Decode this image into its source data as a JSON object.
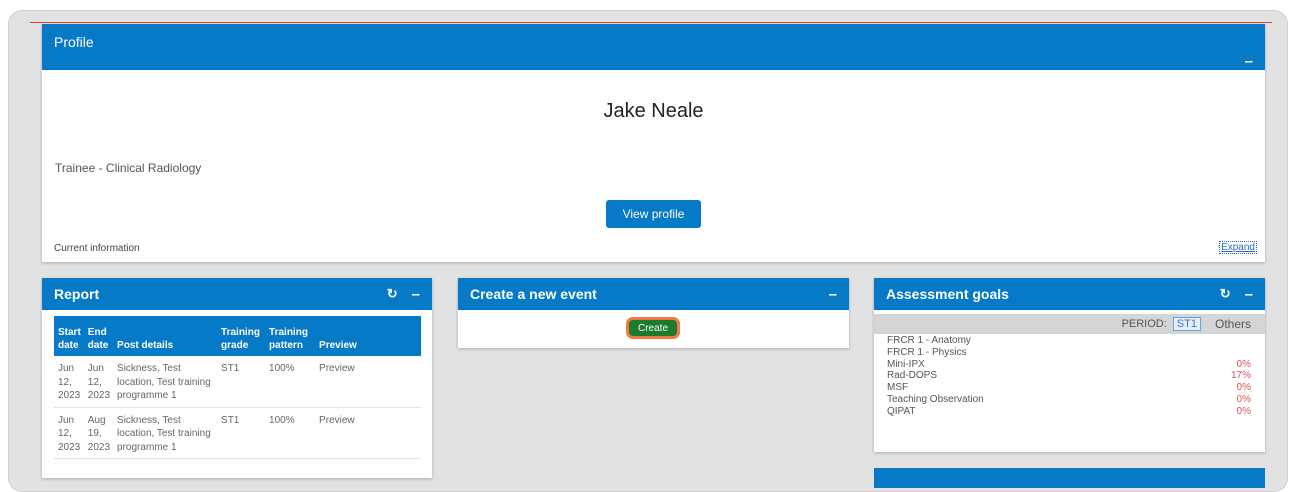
{
  "profile": {
    "header_title": "Profile",
    "minimize_glyph": "–",
    "name": "Jake Neale",
    "role": "Trainee - Clinical Radiology",
    "view_profile_label": "View profile",
    "current_info_label": "Current information",
    "expand_label": "Expand"
  },
  "report": {
    "header_title": "Report",
    "refresh_glyph": "↻",
    "minimize_glyph": "–",
    "columns": [
      "Start date",
      "End date",
      "Post details",
      "Training grade",
      "Training pattern",
      "Preview"
    ],
    "rows": [
      {
        "start": "Jun 12, 2023",
        "end": "Jun 12, 2023",
        "post": "Sickness, Test location, Test training programme 1",
        "grade": "ST1",
        "pattern": "100%",
        "preview": "Preview"
      },
      {
        "start": "Jun 12, 2023",
        "end": "Aug 19, 2023",
        "post": "Sickness, Test location, Test training programme 1",
        "grade": "ST1",
        "pattern": "100%",
        "preview": "Preview"
      }
    ]
  },
  "create_event": {
    "header_title": "Create a new event",
    "minimize_glyph": "–",
    "create_label": "Create"
  },
  "assessment_goals": {
    "header_title": "Assessment goals",
    "refresh_glyph": "↻",
    "minimize_glyph": "–",
    "period_label": "PERIOD:",
    "period_selected": "ST1",
    "period_other": "Others",
    "goals": [
      {
        "name": "FRCR 1 - Anatomy",
        "pct": ""
      },
      {
        "name": "FRCR 1 - Physics",
        "pct": ""
      },
      {
        "name": "Mini-IPX",
        "pct": "0%"
      },
      {
        "name": "Rad-DOPS",
        "pct": "17%"
      },
      {
        "name": "MSF",
        "pct": "0%"
      },
      {
        "name": "Teaching Observation",
        "pct": "0%"
      },
      {
        "name": "QIPAT",
        "pct": "0%"
      }
    ]
  },
  "colors": {
    "header_blue": "#0679c7",
    "create_green": "#1d7a2e",
    "highlight_orange": "#f07a40",
    "percent_red": "#e05050"
  }
}
